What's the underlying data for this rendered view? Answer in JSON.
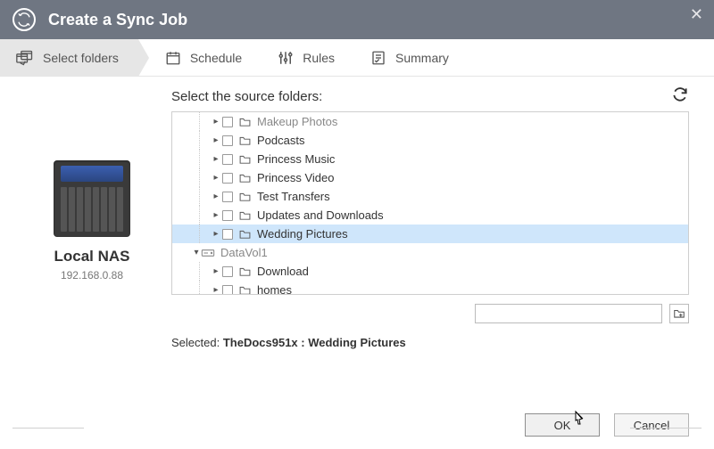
{
  "title": "Create a Sync Job",
  "steps": {
    "select_folders": "Select folders",
    "schedule": "Schedule",
    "rules": "Rules",
    "summary": "Summary"
  },
  "source": {
    "name": "Local NAS",
    "ip": "192.168.0.88"
  },
  "section_label": "Select the source folders:",
  "tree": {
    "items": [
      {
        "label": "Makeup Photos",
        "depth": 2,
        "cutoff": true
      },
      {
        "label": "Podcasts",
        "depth": 2
      },
      {
        "label": "Princess Music",
        "depth": 2
      },
      {
        "label": "Princess Video",
        "depth": 2
      },
      {
        "label": "Test Transfers",
        "depth": 2
      },
      {
        "label": "Updates and Downloads",
        "depth": 2
      },
      {
        "label": "Wedding Pictures",
        "depth": 2,
        "selected": true
      },
      {
        "label": "DataVol1",
        "depth": 1,
        "type": "volume",
        "expanded": true
      },
      {
        "label": "Download",
        "depth": 2
      },
      {
        "label": "homes",
        "depth": 2
      }
    ]
  },
  "path_input": "",
  "selected_label": "Selected:",
  "selected_value": "TheDocs951x : Wedding Pictures",
  "buttons": {
    "ok": "OK",
    "cancel": "Cancel"
  }
}
